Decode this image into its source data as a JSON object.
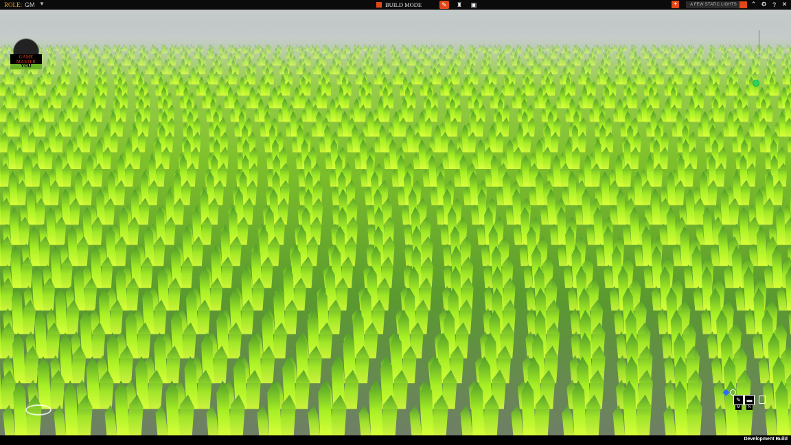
{
  "topbar": {
    "role_label": "ROLE:",
    "role_value": "GM",
    "role_caret": "▼",
    "mode_label": "BUILD MODE",
    "mode_icon_pencil": "✎",
    "mode_icon_piece": "♜",
    "mode_icon_film": "▣",
    "add_label": "+",
    "lights_value": "A FEW STATIC LIGHTS",
    "icon_up": "⌃",
    "icon_gear": "⚙",
    "icon_help": "?",
    "icon_close": "✕"
  },
  "avatar": {
    "title_line1": "GAME",
    "title_line2": "MASTER",
    "you_label": "YOU"
  },
  "tools": {
    "draw_icon": "✎",
    "draw_key": "M",
    "line_icon": "▬",
    "line_key": "N"
  },
  "footer": {
    "build_label": "Development Build"
  },
  "colors": {
    "accent": "#e0481a",
    "crystal": "#9eea1e",
    "ground": "#6f7f66"
  }
}
